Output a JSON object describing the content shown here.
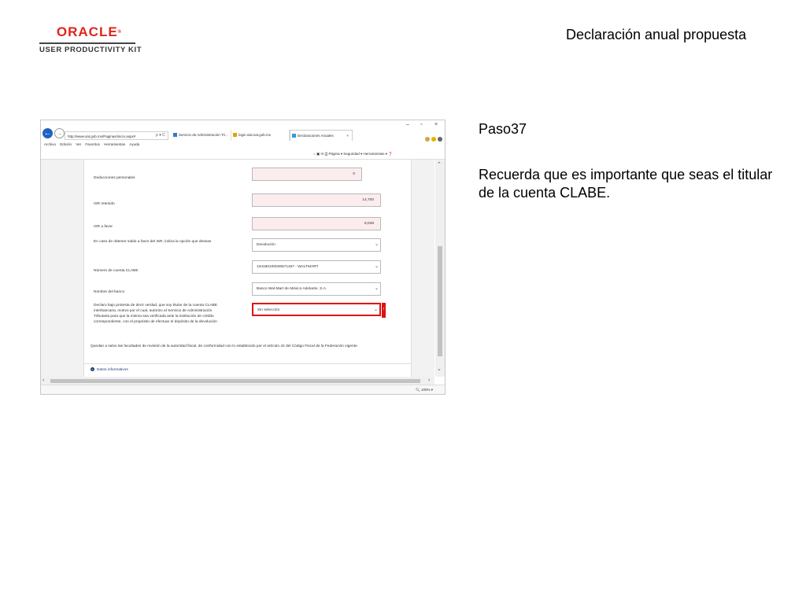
{
  "header": {
    "brand": "ORACLE",
    "brand_mark": "®",
    "product": "USER PRODUCTIVITY KIT",
    "title": "Declaración anual propuesta"
  },
  "step": {
    "label": "Paso37",
    "instruction": "Recuerda que es importante que seas el titular de la cuenta CLABE."
  },
  "browser": {
    "url": "http://www.sat.gob.mx/Paginas/inicio.aspx#",
    "address_icons": "ρ ▾ C",
    "tabs": [
      {
        "label": "Servicio de Administración Tri..."
      },
      {
        "label": "login.siat.sat.gob.mx"
      },
      {
        "label": "Declaraciones Anuales",
        "close": "×"
      }
    ],
    "window_controls": [
      "–",
      "▫",
      "×"
    ],
    "menu": [
      "Archivo",
      "Edición",
      "Ver",
      "Favoritos",
      "Herramientas",
      "Ayuda"
    ],
    "command_bar": [
      "Página ▾",
      "Seguridad ▾",
      "Herramientas ▾"
    ],
    "zoom": "100%"
  },
  "form": {
    "fields": [
      {
        "label": "Deducciones personales",
        "value": "0"
      },
      {
        "label": "ISR retenido",
        "value": "14,700"
      },
      {
        "label": "ISR a favor",
        "value": "8,049"
      },
      {
        "label": "En caso de obtener saldo a favor del ISR, indica la opción que deseas",
        "value": "Devolución"
      },
      {
        "label": "Número de cuenta CLABE",
        "value": "134180100046571467 - WALTMART"
      },
      {
        "label": "Nombre del banco",
        "value": "Banco Wal-Mart de México Adelante, S.A."
      },
      {
        "label": "Declaro bajo protesta de decir verdad, que soy titular de la cuenta CLABE interbancaria, motivo por el cual, autorizo al Servicio de Administración Tributaria para que la misma sea verificada ante la institución de crédito correspondiente, con el propósito de efectuar el depósito de la devolución",
        "value": "Sin selección"
      }
    ],
    "error_mark": "!",
    "footnote": "Quedan a salvo las facultades de revisión de la autoridad fiscal, de conformidad con lo establecido por el artículo 42 del Código Fiscal de la Federación vigente.",
    "datos_informativos": "Datos informativos"
  }
}
